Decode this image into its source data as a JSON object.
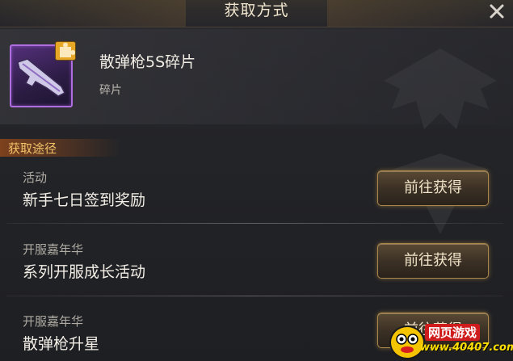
{
  "dialog": {
    "title": "获取方式"
  },
  "item": {
    "name": "散弹枪5S碎片",
    "type": "碎片"
  },
  "section": {
    "label": "获取途径"
  },
  "sources": [
    {
      "category": "活动",
      "name": "新手七日签到奖励",
      "button": "前往获得"
    },
    {
      "category": "开服嘉年华",
      "name": "系列开服成长活动",
      "button": "前往获得"
    },
    {
      "category": "开服嘉年华",
      "name": "散弹枪升星",
      "button": "前往获得"
    }
  ],
  "watermark": {
    "brand": "网页游戏",
    "url": "www.40407.com"
  }
}
